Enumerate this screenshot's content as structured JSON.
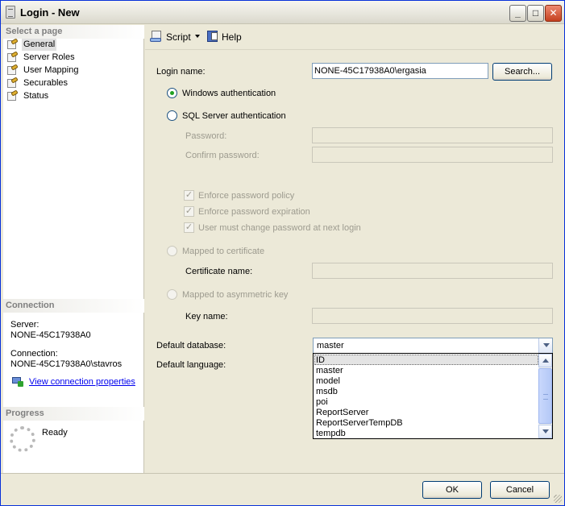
{
  "window": {
    "title": "Login - New"
  },
  "left": {
    "select_page_header": "Select a page",
    "pages": [
      {
        "label": "General"
      },
      {
        "label": "Server Roles"
      },
      {
        "label": "User Mapping"
      },
      {
        "label": "Securables"
      },
      {
        "label": "Status"
      }
    ],
    "connection_header": "Connection",
    "server_label": "Server:",
    "server_value": "NONE-45C17938A0",
    "connection_label": "Connection:",
    "connection_value": "NONE-45C17938A0\\stavros",
    "view_connection_link": "View connection properties",
    "progress_header": "Progress",
    "progress_status": "Ready"
  },
  "toolbar": {
    "script_label": "Script",
    "help_label": "Help"
  },
  "form": {
    "login_name_label": "Login name:",
    "login_name_value": "NONE-45C17938A0\\ergasia",
    "search_button": "Search...",
    "windows_auth_label": "Windows authentication",
    "sql_auth_label": "SQL Server authentication",
    "password_label": "Password:",
    "confirm_password_label": "Confirm password:",
    "enforce_policy_label": "Enforce password policy",
    "enforce_expiration_label": "Enforce password expiration",
    "must_change_label": "User must change password at next login",
    "mapped_cert_label": "Mapped to certificate",
    "certificate_name_label": "Certificate name:",
    "mapped_asym_label": "Mapped to asymmetric key",
    "key_name_label": "Key name:",
    "default_database_label": "Default database:",
    "default_database_value": "master",
    "default_language_label": "Default language:",
    "database_options": [
      "ID",
      "master",
      "model",
      "msdb",
      "poi",
      "ReportServer",
      "ReportServerTempDB",
      "tempdb"
    ]
  },
  "footer": {
    "ok_button": "OK",
    "cancel_button": "Cancel"
  }
}
